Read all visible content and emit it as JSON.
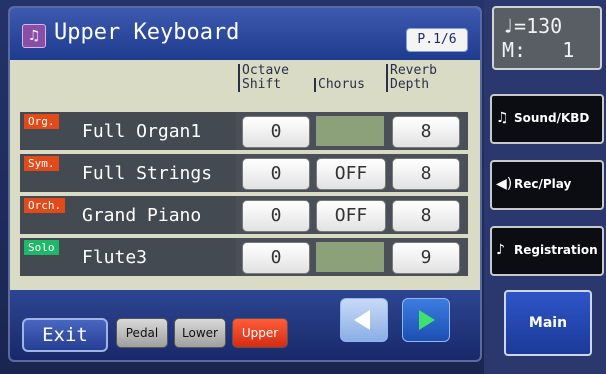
{
  "screen": {
    "title": "Upper Keyboard",
    "title_icon": "♫",
    "page_indicator": "P.1/6",
    "columns": {
      "octave_shift": [
        "Octave",
        "Shift"
      ],
      "chorus": "Chorus",
      "reverb_depth": [
        "Reverb",
        "Depth"
      ]
    },
    "rows": [
      {
        "badge": "Org.",
        "badge_color": "#e24a1a",
        "name": "Full Organ1",
        "octave": "0",
        "chorus": "",
        "reverb": "8"
      },
      {
        "badge": "Sym.",
        "badge_color": "#e24a1a",
        "name": "Full Strings",
        "octave": "0",
        "chorus": "OFF",
        "reverb": "8"
      },
      {
        "badge": "Orch.",
        "badge_color": "#e24a1a",
        "name": "Grand Piano",
        "octave": "0",
        "chorus": "OFF",
        "reverb": "8"
      },
      {
        "badge": "Solo",
        "badge_color": "#1fb86a",
        "name": "Flute3",
        "octave": "0",
        "chorus": "",
        "reverb": "9"
      }
    ],
    "bottom": {
      "exit_label": "Exit",
      "keyboard_buttons": [
        {
          "label": "Pedal",
          "active": false
        },
        {
          "label": "Lower",
          "active": false
        },
        {
          "label": "Upper",
          "active": true
        }
      ]
    }
  },
  "sidebar": {
    "display": {
      "tempo": "♩=130",
      "measure": "M:   1"
    },
    "buttons": [
      {
        "label": "Sound/KBD",
        "icon": "♫"
      },
      {
        "label": "Rec/Play",
        "icon": "◀)"
      },
      {
        "label": "Registration",
        "icon": "♪"
      }
    ],
    "main_label": "Main"
  },
  "colors": {
    "badge_orange": "#e24a1a",
    "badge_green": "#1fb86a",
    "active_part": "#e33a1c",
    "chorus_off_cell": "#8ca07a"
  }
}
